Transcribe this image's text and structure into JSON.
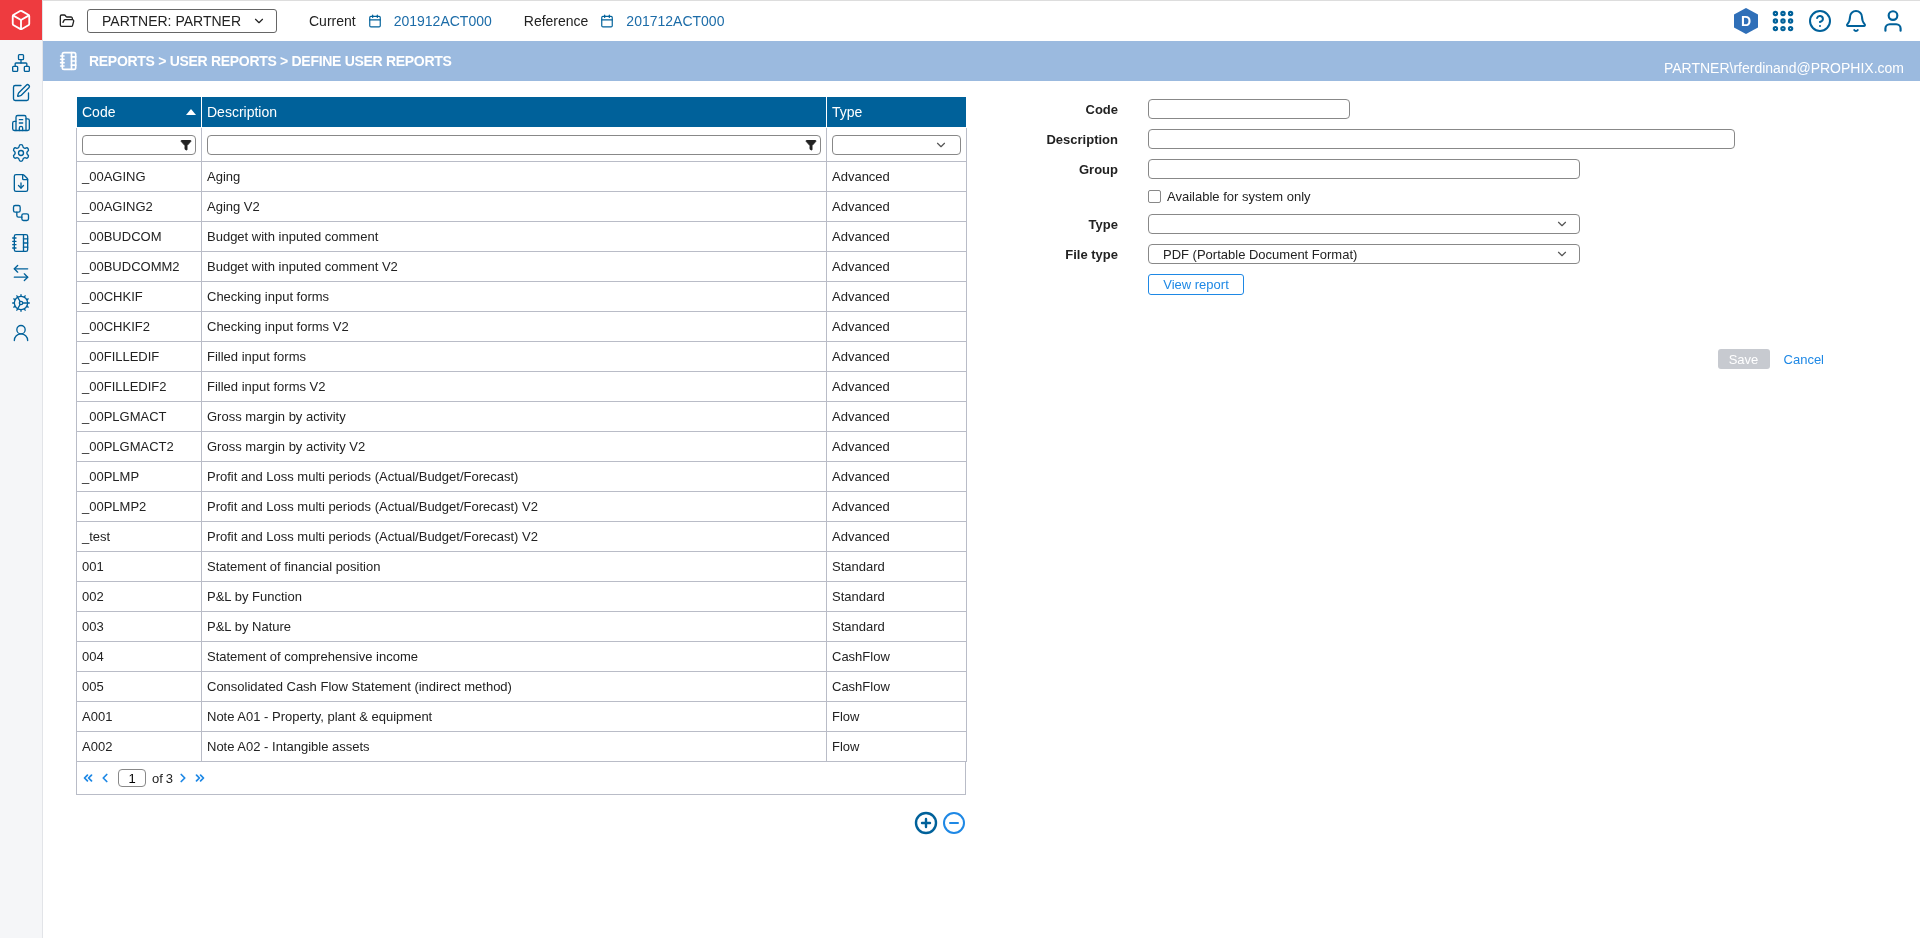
{
  "topbar": {
    "dimension_select": "PARTNER: PARTNER",
    "current_label": "Current",
    "current_value": "201912ACT000",
    "reference_label": "Reference",
    "reference_value": "201712ACT000",
    "badge": "D"
  },
  "breadcrumb": {
    "path": "REPORTS > USER REPORTS > DEFINE USER REPORTS",
    "user": "PARTNER\\rferdinand@PROPHIX.com"
  },
  "table": {
    "columns": [
      {
        "label": "Code",
        "sorted": true
      },
      {
        "label": "Description",
        "sorted": false
      },
      {
        "label": "Type",
        "sorted": false
      }
    ],
    "rows": [
      {
        "code": "_00AGING",
        "description": "Aging",
        "type": "Advanced"
      },
      {
        "code": "_00AGING2",
        "description": "Aging V2",
        "type": "Advanced"
      },
      {
        "code": "_00BUDCOM",
        "description": "Budget with inputed comment",
        "type": "Advanced"
      },
      {
        "code": "_00BUDCOMM2",
        "description": "Budget with inputed comment V2",
        "type": "Advanced"
      },
      {
        "code": "_00CHKIF",
        "description": "Checking input forms",
        "type": "Advanced"
      },
      {
        "code": "_00CHKIF2",
        "description": "Checking input forms V2",
        "type": "Advanced"
      },
      {
        "code": "_00FILLEDIF",
        "description": "Filled input forms",
        "type": "Advanced"
      },
      {
        "code": "_00FILLEDIF2",
        "description": "Filled input forms V2",
        "type": "Advanced"
      },
      {
        "code": "_00PLGMACT",
        "description": "Gross margin by activity",
        "type": "Advanced"
      },
      {
        "code": "_00PLGMACT2",
        "description": "Gross margin by activity V2",
        "type": "Advanced"
      },
      {
        "code": "_00PLMP",
        "description": "Profit and Loss multi periods (Actual/Budget/Forecast)",
        "type": "Advanced"
      },
      {
        "code": "_00PLMP2",
        "description": "Profit and Loss multi periods (Actual/Budget/Forecast) V2",
        "type": "Advanced"
      },
      {
        "code": "_test",
        "description": "Profit and Loss multi periods (Actual/Budget/Forecast) V2",
        "type": "Advanced"
      },
      {
        "code": "001",
        "description": "Statement of financial position",
        "type": "Standard"
      },
      {
        "code": "002",
        "description": "P&L by Function",
        "type": "Standard"
      },
      {
        "code": "003",
        "description": "P&L by Nature",
        "type": "Standard"
      },
      {
        "code": "004",
        "description": "Statement of comprehensive income",
        "type": "CashFlow"
      },
      {
        "code": "005",
        "description": "Consolidated Cash Flow Statement (indirect method)",
        "type": "CashFlow"
      },
      {
        "code": "A001",
        "description": "Note A01 - Property, plant & equipment",
        "type": "Flow"
      },
      {
        "code": "A002",
        "description": "Note A02 - Intangible assets",
        "type": "Flow"
      }
    ],
    "pagination": {
      "page": "1",
      "of": "of",
      "total": "3"
    }
  },
  "form": {
    "fields": [
      {
        "kind": "text",
        "label": "Code"
      },
      {
        "kind": "text",
        "label": "Description"
      },
      {
        "kind": "text",
        "label": "Group"
      },
      {
        "kind": "checkbox",
        "label": "Available for system only",
        "checked": false
      },
      {
        "kind": "select",
        "label": "Type"
      },
      {
        "kind": "select",
        "label": "File type",
        "value": "PDF (Portable Document Format)"
      }
    ],
    "view_button": "View report",
    "save": {
      "label": "Save",
      "disabled": true
    },
    "cancel": "Cancel"
  }
}
